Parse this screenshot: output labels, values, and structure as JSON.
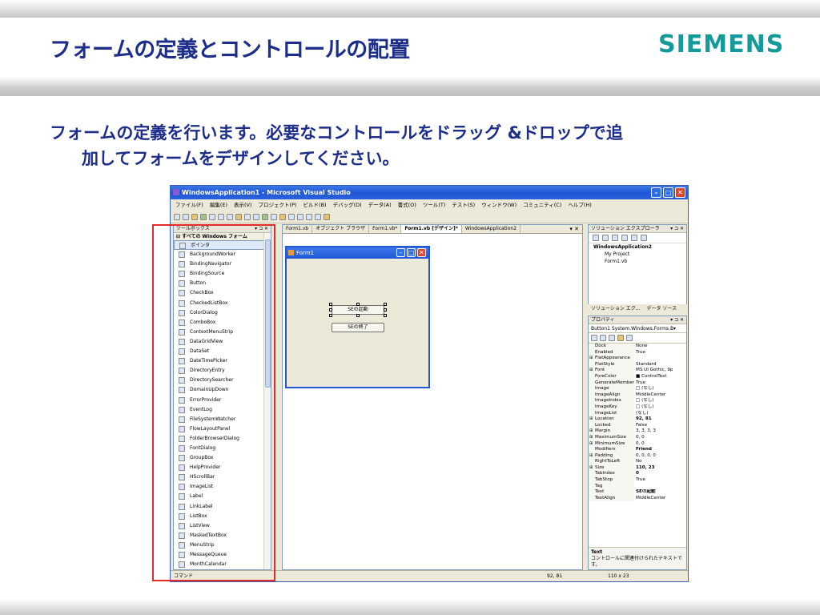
{
  "slide": {
    "title": "フォームの定義とコントロールの配置",
    "brand": "SIEMENS",
    "body_line1": "フォームの定義を行います。必要なコントロールをドラッグ &ドロップで追",
    "body_line2": "加してフォームをデザインしてください。"
  },
  "vs": {
    "window_title": "WindowsApplication1 - Microsoft Visual Studio",
    "menu": [
      "ファイル(F)",
      "編集(E)",
      "表示(V)",
      "プロジェクト(P)",
      "ビルド(B)",
      "デバッグ(D)",
      "データ(A)",
      "書式(O)",
      "ツール(T)",
      "テスト(S)",
      "ウィンドウ(W)",
      "コミュニティ(C)",
      "ヘルプ(H)"
    ],
    "toolbox": {
      "header": "ツールボックス",
      "header_controls": "▾ ⊐ ✕",
      "category": "⊟ すべての Windows フォーム",
      "items": [
        "ポインタ",
        "BackgroundWorker",
        "BindingNavigator",
        "BindingSource",
        "Button",
        "CheckBox",
        "CheckedListBox",
        "ColorDialog",
        "ComboBox",
        "ContextMenuStrip",
        "DataGridView",
        "DataSet",
        "DateTimePicker",
        "DirectoryEntry",
        "DirectorySearcher",
        "DomainUpDown",
        "ErrorProvider",
        "EventLog",
        "FileSystemWatcher",
        "FlowLayoutPanel",
        "FolderBrowserDialog",
        "FontDialog",
        "GroupBox",
        "HelpProvider",
        "HScrollBar",
        "ImageList",
        "Label",
        "LinkLabel",
        "ListBox",
        "ListView",
        "MaskedTextBox",
        "MenuStrip",
        "MessageQueue",
        "MonthCalendar"
      ]
    },
    "tabs": [
      "Form1.vb",
      "オブジェクト ブラウザ",
      "Form1.vb*",
      "Form1.vb [デザイン]*",
      "WindowsApplication2"
    ],
    "tab_close": "▾ ✕",
    "form": {
      "title": "Form1",
      "button1": "SEの起動",
      "button2": "SEの終了"
    },
    "solution": {
      "header": "ソリューション エクスプローラ",
      "header_controls": "▾ ⊐ ✕",
      "project": "WindowsApplication2",
      "items": [
        "My Project",
        "Form1.vb"
      ],
      "tab1": "ソリューション エク...",
      "tab2": "データ ソース"
    },
    "properties": {
      "header": "プロパティ",
      "header_controls": "▾ ⊐ ✕",
      "object": "Button1 System.Windows.Forms.B▾",
      "rows": [
        {
          "exp": "",
          "name": "Dock",
          "value": "None",
          "bold": false
        },
        {
          "exp": "",
          "name": "Enabled",
          "value": "True",
          "bold": false
        },
        {
          "exp": "⊞",
          "name": "FlatAppearance",
          "value": "",
          "bold": false
        },
        {
          "exp": "",
          "name": "FlatStyle",
          "value": "Standard",
          "bold": false
        },
        {
          "exp": "⊞",
          "name": "Font",
          "value": "MS UI Gothic, 9p",
          "bold": false
        },
        {
          "exp": "",
          "name": "ForeColor",
          "value": "■ ControlText",
          "bold": false
        },
        {
          "exp": "",
          "name": "GenerateMember",
          "value": "True",
          "bold": false
        },
        {
          "exp": "",
          "name": "Image",
          "value": "□ (なし)",
          "bold": false
        },
        {
          "exp": "",
          "name": "ImageAlign",
          "value": "MiddleCenter",
          "bold": false
        },
        {
          "exp": "",
          "name": "ImageIndex",
          "value": "□ (なし)",
          "bold": false
        },
        {
          "exp": "",
          "name": "ImageKey",
          "value": "□ (なし)",
          "bold": false
        },
        {
          "exp": "",
          "name": "ImageList",
          "value": "(なし)",
          "bold": false
        },
        {
          "exp": "⊞",
          "name": "Location",
          "value": "92, 81",
          "bold": true
        },
        {
          "exp": "",
          "name": "Locked",
          "value": "False",
          "bold": false
        },
        {
          "exp": "⊞",
          "name": "Margin",
          "value": "3, 3, 3, 3",
          "bold": false
        },
        {
          "exp": "⊞",
          "name": "MaximumSize",
          "value": "0, 0",
          "bold": false
        },
        {
          "exp": "⊞",
          "name": "MinimumSize",
          "value": "0, 0",
          "bold": false
        },
        {
          "exp": "",
          "name": "Modifiers",
          "value": "Friend",
          "bold": true
        },
        {
          "exp": "⊞",
          "name": "Padding",
          "value": "0, 0, 0, 0",
          "bold": false
        },
        {
          "exp": "",
          "name": "RightToLeft",
          "value": "No",
          "bold": false
        },
        {
          "exp": "⊞",
          "name": "Size",
          "value": "110, 23",
          "bold": true
        },
        {
          "exp": "",
          "name": "TabIndex",
          "value": "0",
          "bold": true
        },
        {
          "exp": "",
          "name": "TabStop",
          "value": "True",
          "bold": false
        },
        {
          "exp": "",
          "name": "Tag",
          "value": "",
          "bold": false
        },
        {
          "exp": "",
          "name": "Text",
          "value": "SEの起動",
          "bold": true
        },
        {
          "exp": "",
          "name": "TextAlign",
          "value": "MiddleCenter",
          "bold": false
        }
      ],
      "desc_title": "Text",
      "desc_text": "コントロールに関連付けられたテキストです。"
    },
    "status": {
      "left": "コマンド",
      "position": "92, 81",
      "size": "110 x 23"
    }
  }
}
